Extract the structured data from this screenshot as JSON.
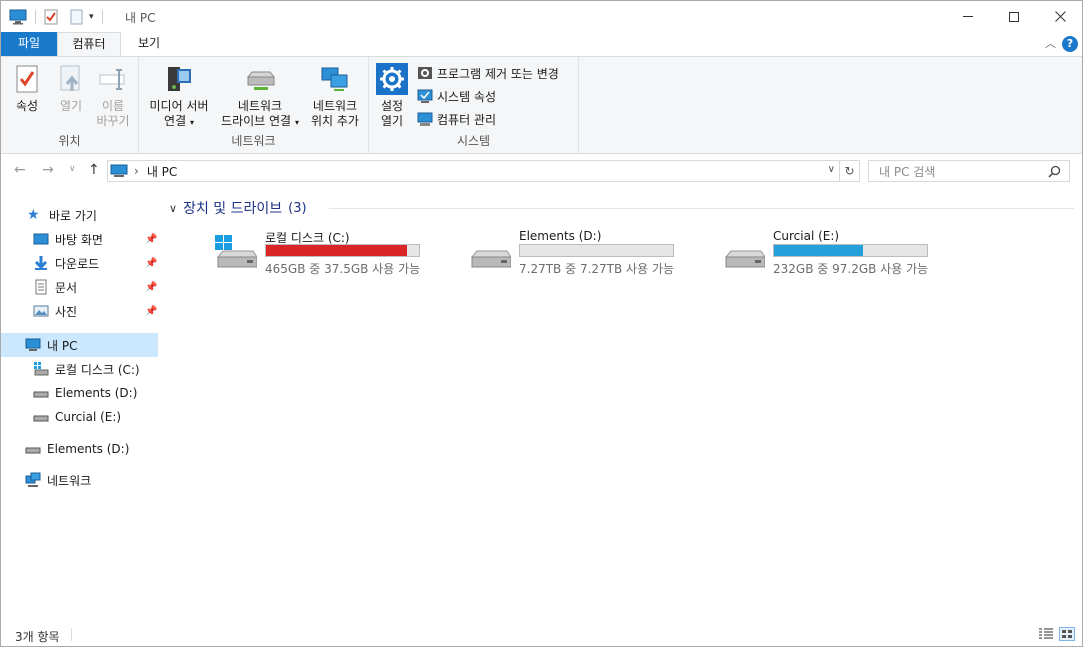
{
  "window": {
    "title": "내 PC"
  },
  "titlebar": {
    "minimize_icon": "minimize-icon",
    "maximize_icon": "maximize-icon",
    "close_icon": "close-icon",
    "minimize": "—",
    "maximize": "☐",
    "close": "✕"
  },
  "tabs": {
    "file": "파일",
    "computer": "컴퓨터",
    "view": "보기",
    "help": "?"
  },
  "ribbon": {
    "location": {
      "label": "위치",
      "properties": "속성",
      "open": "열기",
      "rename_1": "이름",
      "rename_2": "바꾸기"
    },
    "network": {
      "label": "네트워크",
      "media_1": "미디어 서버",
      "media_2": "연결",
      "map_1": "네트워크",
      "map_2": "드라이브 연결",
      "add_1": "네트워크",
      "add_2": "위치 추가"
    },
    "system": {
      "label": "시스템",
      "settings_1": "설정",
      "settings_2": "열기",
      "uninstall": "프로그램 제거 또는 변경",
      "sys_props": "시스템 속성",
      "manage": "컴퓨터 관리"
    }
  },
  "address": {
    "path": "내 PC",
    "separator": "›",
    "search_placeholder": "내 PC 검색"
  },
  "navpane": {
    "quick_access": "바로 가기",
    "desktop": "바탕 화면",
    "downloads": "다운로드",
    "documents": "문서",
    "pictures": "사진",
    "this_pc": "내 PC",
    "local_c": "로컬 디스크 (C:)",
    "elements_d": "Elements (D:)",
    "curcial_e": "Curcial (E:)",
    "elements_d_root": "Elements (D:)",
    "network": "네트워크"
  },
  "content": {
    "section_title": "장치 및 드라이브",
    "section_count": "(3)",
    "drives": [
      {
        "name": "로컬 디스크 (C:)",
        "free": "465GB 중 37.5GB 사용 가능",
        "used_fraction": 0.92,
        "color": "#da2626",
        "icon": "windows-drive-icon"
      },
      {
        "name": "Elements (D:)",
        "free": "7.27TB 중 7.27TB 사용 가능",
        "used_fraction": 0.0,
        "color": "#26a0da",
        "icon": "drive-icon"
      },
      {
        "name": "Curcial (E:)",
        "free": "232GB 중 97.2GB 사용 가능",
        "used_fraction": 0.58,
        "color": "#26a0da",
        "icon": "drive-icon"
      }
    ]
  },
  "status": {
    "items": "3개 항목"
  },
  "colors": {
    "accent": "#1979ca",
    "selection": "#cce8ff",
    "bar_critical": "#da2626",
    "bar_normal": "#26a0da"
  }
}
